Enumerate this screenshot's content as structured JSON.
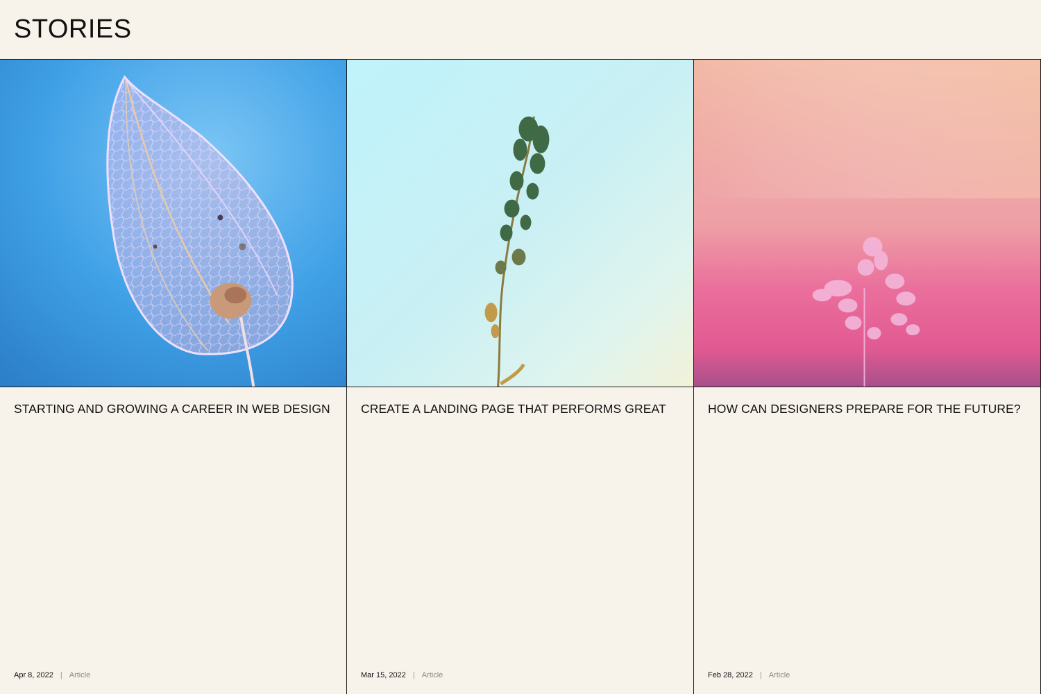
{
  "header": {
    "title": "STORIES"
  },
  "cards": [
    {
      "title": "STARTING AND GROWING A CAREER IN WEB DESIGN",
      "date": "Apr 8, 2022",
      "separator": "|",
      "type": "Article",
      "image": "lantern-leaf-skeleton-on-blue"
    },
    {
      "title": "CREATE A LANDING PAGE THAT PERFORMS GREAT",
      "date": "Mar 15, 2022",
      "separator": "|",
      "type": "Article",
      "image": "dried-plant-stem-on-cyan"
    },
    {
      "title": "HOW CAN DESIGNERS PREPARE FOR THE FUTURE?",
      "date": "Feb 28, 2022",
      "separator": "|",
      "type": "Article",
      "image": "white-fern-on-pink-gradient"
    }
  ],
  "colors": {
    "background": "#f7f3eb",
    "rule": "#1a1a1a",
    "muted": "#8a8a8a"
  }
}
